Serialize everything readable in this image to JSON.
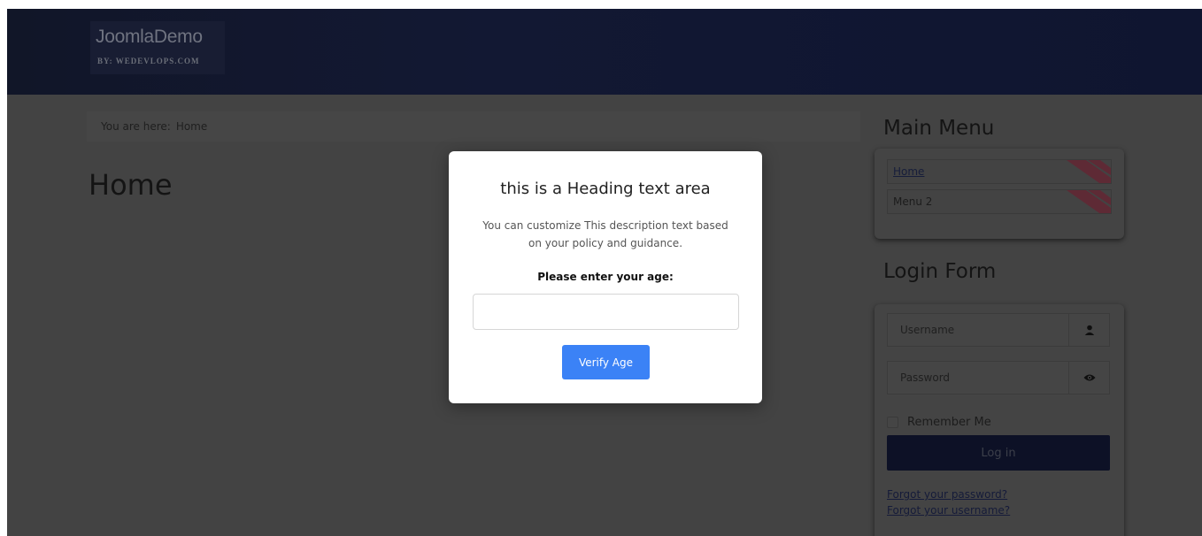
{
  "header": {
    "logo_title": "JoomlaDemo",
    "logo_subtitle": "BY: WEDEVLOPS.COM"
  },
  "breadcrumb": {
    "prefix": "You are here:",
    "current": "Home"
  },
  "page": {
    "title": "Home"
  },
  "sidebar": {
    "main_menu": {
      "title": "Main Menu",
      "items": [
        {
          "label": "Home",
          "active": true
        },
        {
          "label": "Menu 2",
          "active": false
        }
      ]
    },
    "login_form": {
      "title": "Login Form",
      "username_placeholder": "Username",
      "username_icon": "user-icon",
      "password_placeholder": "Password",
      "password_icon": "eye-icon",
      "remember_label": "Remember Me",
      "login_button": "Log in",
      "forgot_password": "Forgot your password?",
      "forgot_username": "Forgot your username?"
    }
  },
  "modal": {
    "heading": "this is a Heading text area",
    "description": "You can customize This description text based on your policy and guidance.",
    "age_label": "Please enter your age:",
    "age_value": "",
    "button": "Verify Age"
  },
  "colors": {
    "overlay_background": "#434343",
    "header_background": "#121833",
    "verify_button": "#3b82f6",
    "login_button": "#0d1126",
    "menu_stripe": "#c0344f"
  }
}
